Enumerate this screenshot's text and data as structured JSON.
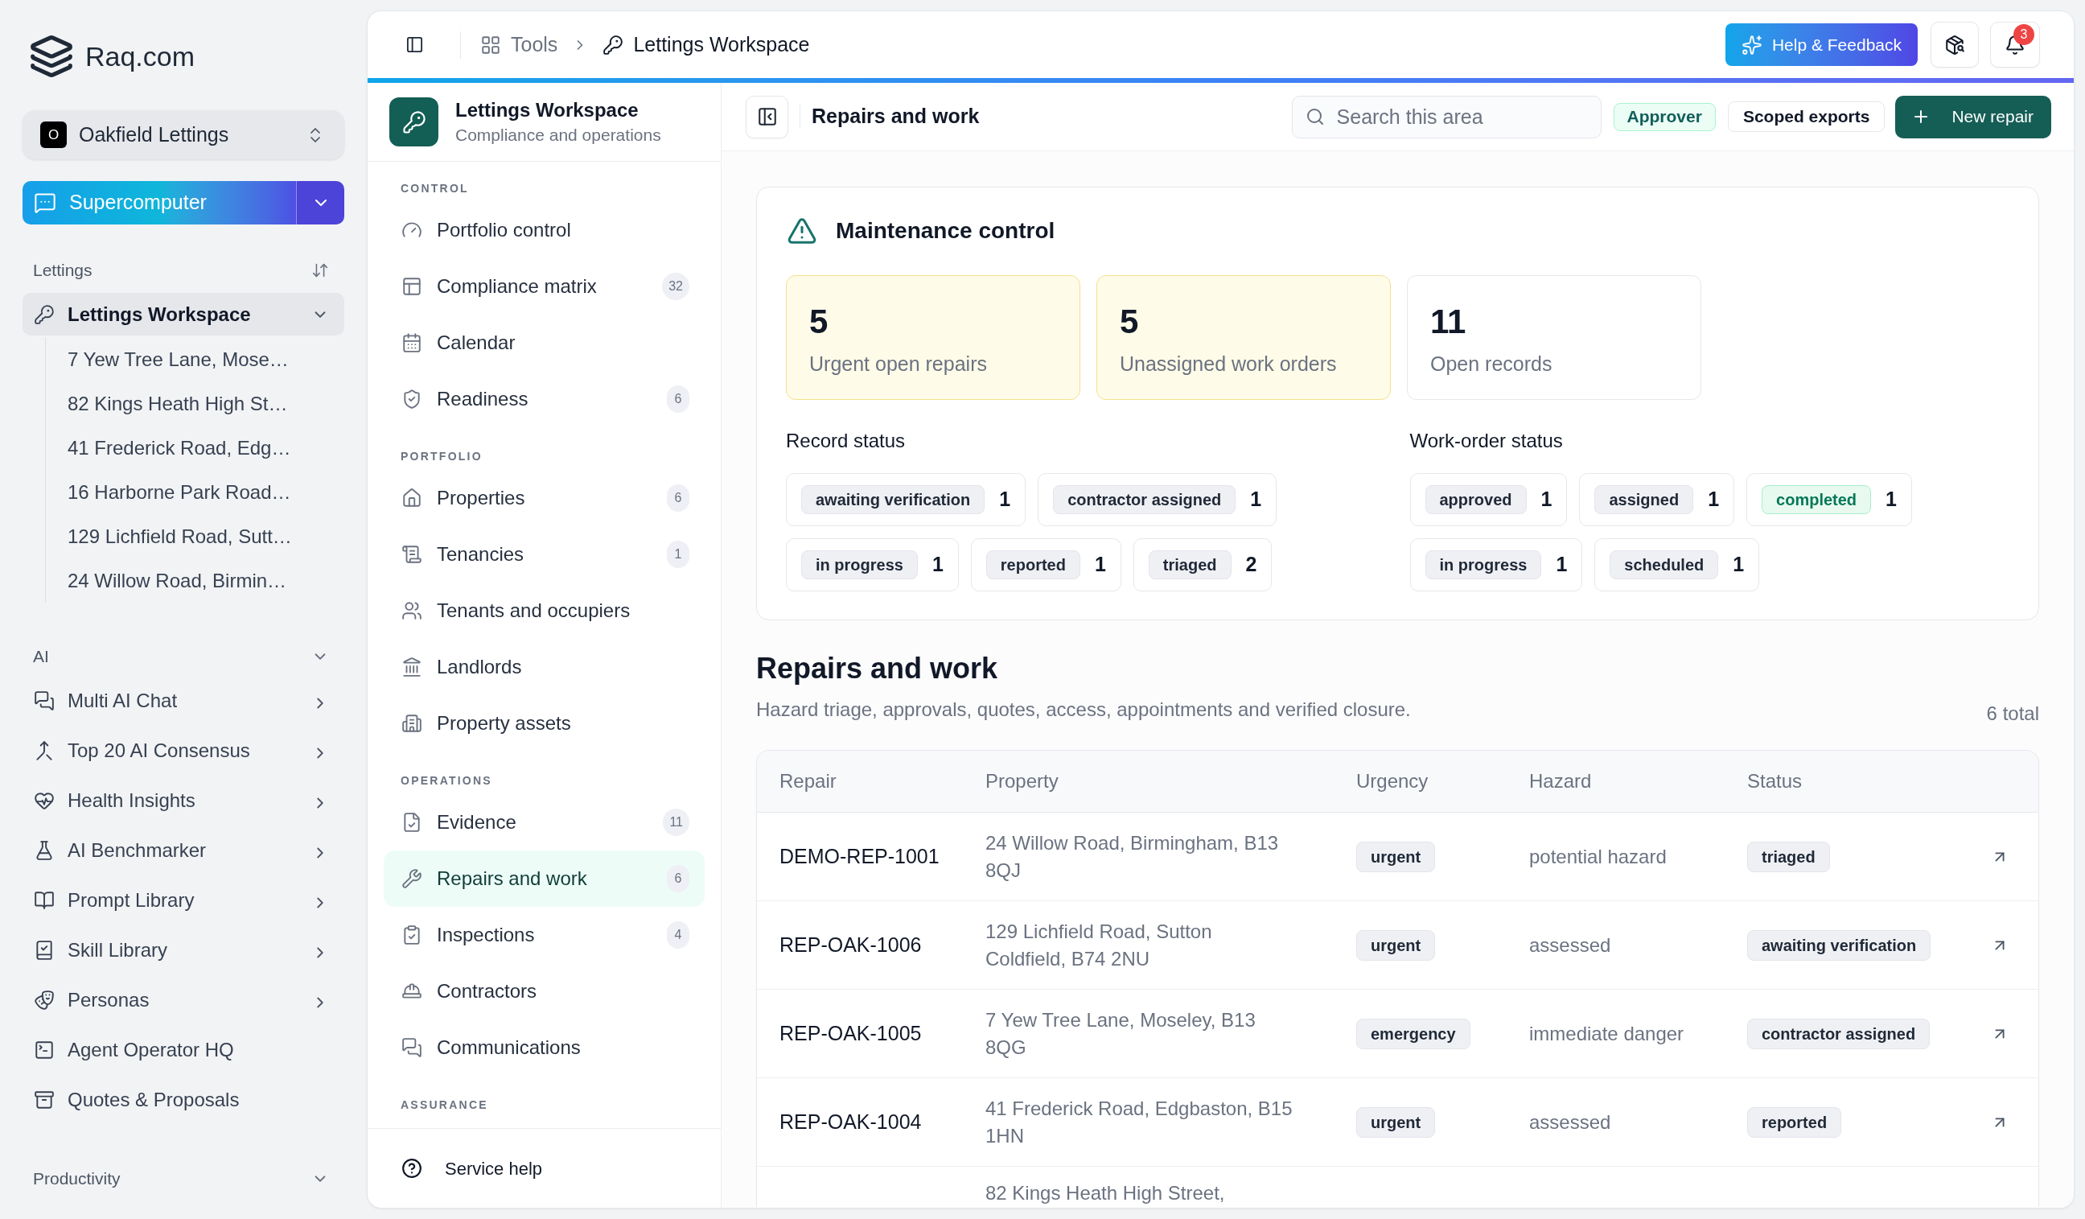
{
  "sidebar": {
    "brand": "Raq.com",
    "organization": {
      "initial": "O",
      "name": "Oakfield Lettings"
    },
    "supercomputer_button": "Supercomputer",
    "sections": [
      {
        "label": "Lettings",
        "kind": "sortable",
        "items": [
          {
            "label": "Lettings Workspace",
            "selected": true,
            "expanded": true,
            "children": [
              {
                "label": "7 Yew Tree Lane, Mose…",
                "selected": false
              },
              {
                "label": "82 Kings Heath High St…",
                "selected": false
              },
              {
                "label": "41 Frederick Road, Edg…",
                "selected": false
              },
              {
                "label": "16 Harborne Park Road…",
                "selected": false
              },
              {
                "label": "129 Lichfield Road, Sutt…",
                "selected": false
              },
              {
                "label": "24 Willow Road, Birmin…",
                "selected": false
              }
            ]
          }
        ]
      },
      {
        "label": "AI",
        "kind": "collapsible",
        "expanded": true,
        "items": [
          {
            "label": "Multi AI Chat",
            "selected": false,
            "submenu": true
          },
          {
            "label": "Top 20 AI Consensus",
            "selected": false,
            "submenu": true
          },
          {
            "label": "Health Insights",
            "selected": false,
            "submenu": true
          },
          {
            "label": "AI Benchmarker",
            "selected": false,
            "submenu": true
          },
          {
            "label": "Prompt Library",
            "selected": false,
            "submenu": true
          },
          {
            "label": "Skill Library",
            "selected": false,
            "submenu": true
          },
          {
            "label": "Personas",
            "selected": false,
            "submenu": true
          },
          {
            "label": "Agent Operator HQ",
            "selected": false,
            "submenu": false
          },
          {
            "label": "Quotes & Proposals",
            "selected": false,
            "submenu": false
          }
        ]
      },
      {
        "label": "Productivity",
        "kind": "collapsible",
        "expanded": true
      }
    ]
  },
  "top_bar": {
    "breadcrumbs": [
      {
        "label": "Tools",
        "current": false
      },
      {
        "label": "Lettings Workspace",
        "current": true
      }
    ],
    "help_button": "Help & Feedback",
    "notification_count": "3"
  },
  "workspace_nav": {
    "title": "Lettings Workspace",
    "subtitle": "Compliance and operations",
    "groups": [
      {
        "label": "CONTROL",
        "items": [
          {
            "label": "Portfolio control",
            "selected": false
          },
          {
            "label": "Compliance matrix",
            "count": "32",
            "selected": false
          },
          {
            "label": "Calendar",
            "selected": false
          },
          {
            "label": "Readiness",
            "count": "6",
            "selected": false
          }
        ]
      },
      {
        "label": "PORTFOLIO",
        "items": [
          {
            "label": "Properties",
            "count": "6",
            "selected": false
          },
          {
            "label": "Tenancies",
            "count": "1",
            "selected": false
          },
          {
            "label": "Tenants and occupiers",
            "selected": false
          },
          {
            "label": "Landlords",
            "selected": false
          },
          {
            "label": "Property assets",
            "selected": false
          }
        ]
      },
      {
        "label": "OPERATIONS",
        "items": [
          {
            "label": "Evidence",
            "count": "11",
            "selected": false
          },
          {
            "label": "Repairs and work",
            "count": "6",
            "selected": true
          },
          {
            "label": "Inspections",
            "count": "4",
            "selected": false
          },
          {
            "label": "Contractors",
            "selected": false
          },
          {
            "label": "Communications",
            "selected": false
          }
        ]
      },
      {
        "label": "ASSURANCE"
      }
    ],
    "footer_link": "Service help"
  },
  "content": {
    "header": {
      "title": "Repairs and work",
      "search": {
        "placeholder": "Search this area"
      },
      "role": "Approver",
      "export_button": "Scoped exports",
      "new_button": "New repair"
    },
    "maintenance": {
      "title": "Maintenance control",
      "stats": [
        {
          "value": "5",
          "label": "Urgent open repairs",
          "highlighted": true
        },
        {
          "value": "5",
          "label": "Unassigned work orders",
          "highlighted": true
        },
        {
          "value": "11",
          "label": "Open records",
          "highlighted": false
        }
      ],
      "status_groups": [
        {
          "title": "Record status",
          "items": [
            {
              "label": "awaiting verification",
              "count": "1",
              "color": "#eff0f4"
            },
            {
              "label": "contractor assigned",
              "count": "1",
              "color": "#eff0f4"
            },
            {
              "label": "in progress",
              "count": "1",
              "color": "#eff0f4"
            },
            {
              "label": "reported",
              "count": "1",
              "color": "#eff0f4"
            },
            {
              "label": "triaged",
              "count": "2",
              "color": "#eff0f4"
            }
          ]
        },
        {
          "title": "Work-order status",
          "items": [
            {
              "label": "approved",
              "count": "1",
              "color": "#eff0f4"
            },
            {
              "label": "assigned",
              "count": "1",
              "color": "#eff0f4"
            },
            {
              "label": "completed",
              "count": "1",
              "color": "#e8f9f0"
            },
            {
              "label": "in progress",
              "count": "1",
              "color": "#eff0f4"
            },
            {
              "label": "scheduled",
              "count": "1",
              "color": "#eff0f4"
            }
          ]
        }
      ]
    },
    "repairs": {
      "title": "Repairs and work",
      "description": "Hazard triage, approvals, quotes, access, appointments and verified closure.",
      "total": "6 total",
      "table": {
        "columns": [
          "Repair",
          "Property",
          "Urgency",
          "Hazard",
          "Status"
        ],
        "rows": [
          {
            "repair": "DEMO-REP-1001",
            "property": "24 Willow Road, Birmingham, B13 8QJ",
            "urgency": "urgent",
            "hazard": "potential hazard",
            "status": "triaged"
          },
          {
            "repair": "REP-OAK-1006",
            "property": "129 Lichfield Road, Sutton Coldfield, B74 2NU",
            "urgency": "urgent",
            "hazard": "assessed",
            "status": "awaiting verification"
          },
          {
            "repair": "REP-OAK-1005",
            "property": "7 Yew Tree Lane, Moseley, B13 8QG",
            "urgency": "emergency",
            "hazard": "immediate danger",
            "status": "contractor assigned"
          },
          {
            "repair": "REP-OAK-1004",
            "property": "41 Frederick Road, Edgbaston, B15 1HN",
            "urgency": "urgent",
            "hazard": "assessed",
            "status": "reported"
          },
          {
            "property": "82 Kings Heath High Street,"
          }
        ]
      }
    }
  }
}
